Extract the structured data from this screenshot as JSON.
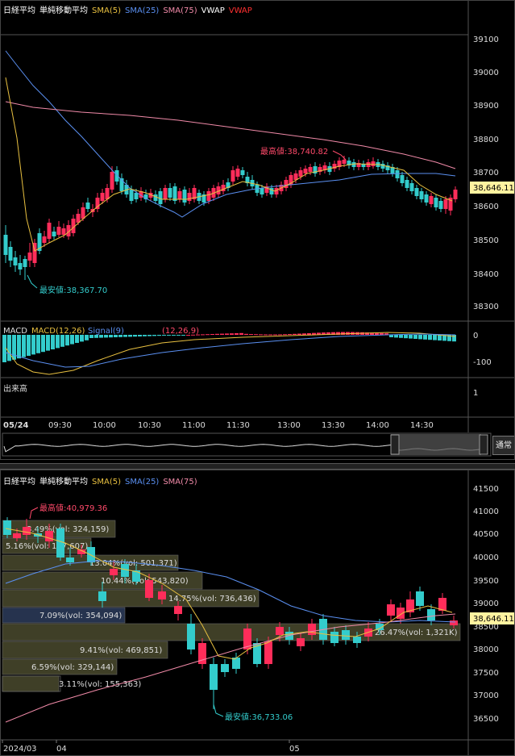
{
  "top_chart": {
    "legend": [
      {
        "text": "日経平均",
        "color": "#ffffff"
      },
      {
        "text": "単純移動平均",
        "color": "#ffffff"
      },
      {
        "text": "SMA(5)",
        "color": "#e8c040"
      },
      {
        "text": "SMA(25)",
        "color": "#5a8ff0"
      },
      {
        "text": "SMA(75)",
        "color": "#f08aa8"
      },
      {
        "text": "VWAP",
        "color": "#ffffff"
      },
      {
        "text": "VWAP",
        "color": "#ff3030"
      }
    ],
    "y_ticks": [
      "39100",
      "39000",
      "38900",
      "38800",
      "38700",
      "38600",
      "38500",
      "38400",
      "38300"
    ],
    "current_price": "38,646.11",
    "high_label": "最高値:38,740.82",
    "low_label": "最安値:38,367.70",
    "macd": {
      "label": "MACD",
      "macd_label": "MACD(12,26)",
      "signal_label": "Signal(9)",
      "hist_label": "(12,26,9)",
      "ticks": [
        "0",
        "-100"
      ]
    },
    "volume": {
      "label": "出来高",
      "tick": "1"
    },
    "x_date": "05/24",
    "x_ticks": [
      "09:30",
      "10:00",
      "10:30",
      "11:00",
      "11:30",
      "13:00",
      "13:30",
      "14:00",
      "14:30"
    ],
    "nav_button": "通常",
    "colors": {
      "up": "#ff2d5a",
      "down": "#33cccc",
      "sma5": "#e8c040",
      "sma25": "#5a8ff0",
      "sma75": "#f08aa8"
    }
  },
  "bottom_chart": {
    "legend": [
      {
        "text": "日経平均",
        "color": "#ffffff"
      },
      {
        "text": "単純移動平均",
        "color": "#ffffff"
      },
      {
        "text": "SMA(5)",
        "color": "#e8c040"
      },
      {
        "text": "SMA(25)",
        "color": "#5a8ff0"
      },
      {
        "text": "SMA(75)",
        "color": "#f08aa8"
      }
    ],
    "y_ticks": [
      "41500",
      "41000",
      "40500",
      "40000",
      "39500",
      "39000",
      "38500",
      "38000",
      "37500",
      "37000",
      "36500"
    ],
    "current_price": "38,646.11",
    "high_label": "最高値:40,979.36",
    "low_label": "最安値:36,733.06",
    "x_ticks": [
      "2024/03",
      "04",
      "05"
    ],
    "volume_profile": [
      {
        "text": "8.49%(vol: 324,159)"
      },
      {
        "text": "5.16%(vol: 197,607)"
      },
      {
        "text": "13.04%(vol: 501,371)"
      },
      {
        "text": "10.44%(vol: 543,820)"
      },
      {
        "text": "14.75%(vol: 736,436)"
      },
      {
        "text": "7.09%(vol: 354,094)"
      },
      {
        "text": "26.47%(vol: 1,321K)"
      },
      {
        "text": "9.41%(vol: 469,851)"
      },
      {
        "text": "6.59%(vol: 329,144)"
      },
      {
        "text": "3.11%(vol: 155,363)"
      }
    ]
  }
}
